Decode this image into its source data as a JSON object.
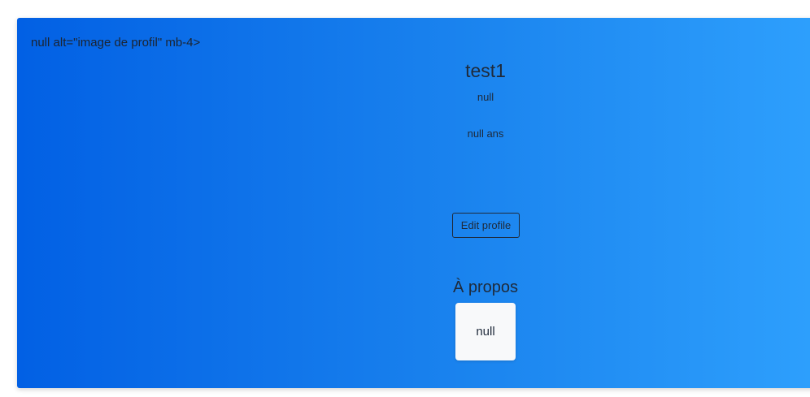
{
  "profile": {
    "broken_image_text": "null alt=\"image de profil\" mb-4>",
    "username": "test1",
    "line1": "null",
    "age_text": "null ans",
    "edit_button_label": "Edit profile",
    "about_title": "À propos",
    "about_text": "null"
  },
  "colors": {
    "gradient_start": "#0260e4",
    "gradient_end": "#2ea0fd",
    "card_text": "#1f2a3a",
    "about_box_bg": "#f8f9fa"
  }
}
